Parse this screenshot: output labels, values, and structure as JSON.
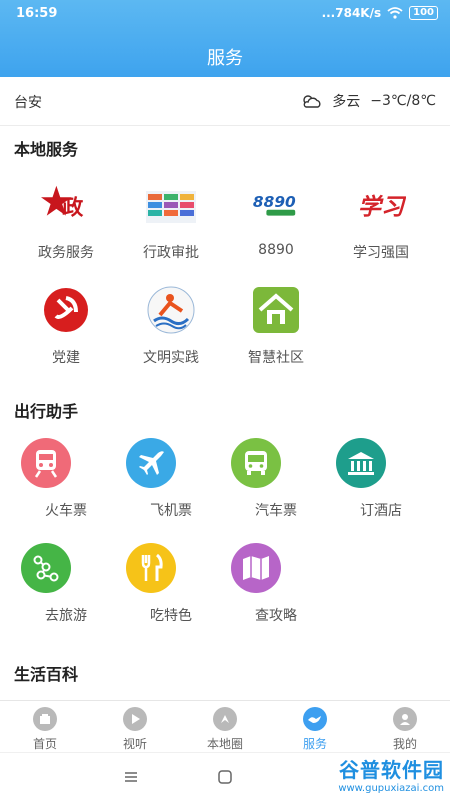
{
  "status": {
    "time": "16:59",
    "network": "...784K/s",
    "battery": "100"
  },
  "header": {
    "title": "服务"
  },
  "weather": {
    "location": "台安",
    "condition": "多云",
    "temp": "−3℃/8℃"
  },
  "sections": {
    "local": "本地服务",
    "travel": "出行助手",
    "life": "生活百科"
  },
  "local_items": [
    {
      "label": "政务服务",
      "icon": "zhengwu-logo-icon"
    },
    {
      "label": "行政审批",
      "icon": "approval-icon"
    },
    {
      "label": "8890",
      "icon": "8890-logo-icon"
    },
    {
      "label": "学习强国",
      "icon": "xuexi-logo-icon"
    },
    {
      "label": "党建",
      "icon": "party-emblem-icon"
    },
    {
      "label": "文明实践",
      "icon": "civilization-icon"
    },
    {
      "label": "智慧社区",
      "icon": "community-house-icon"
    }
  ],
  "travel_items": [
    {
      "label": "火车票",
      "icon": "train-icon",
      "color": "#f06a78"
    },
    {
      "label": "飞机票",
      "icon": "airplane-icon",
      "color": "#3aa9e6"
    },
    {
      "label": "汽车票",
      "icon": "bus-icon",
      "color": "#7ac143"
    },
    {
      "label": "订酒店",
      "icon": "hotel-icon",
      "color": "#1e9e8c"
    },
    {
      "label": "去旅游",
      "icon": "route-icon",
      "color": "#45b546"
    },
    {
      "label": "吃特色",
      "icon": "fork-knife-icon",
      "color": "#f6c318"
    },
    {
      "label": "查攻略",
      "icon": "map-icon",
      "color": "#b765c8"
    }
  ],
  "tabs": [
    {
      "label": "首页",
      "icon": "home-icon"
    },
    {
      "label": "视听",
      "icon": "play-icon"
    },
    {
      "label": "本地圈",
      "icon": "local-circle-icon"
    },
    {
      "label": "服务",
      "icon": "service-icon",
      "active": true
    },
    {
      "label": "我的",
      "icon": "profile-icon"
    }
  ],
  "watermark": {
    "title": "谷普软件园",
    "url": "www.gupuxiazai.com"
  },
  "colors": {
    "header_top": "#5cb8f2",
    "header_bottom": "#3ea3ee",
    "active_tab": "#3d9ff0"
  }
}
